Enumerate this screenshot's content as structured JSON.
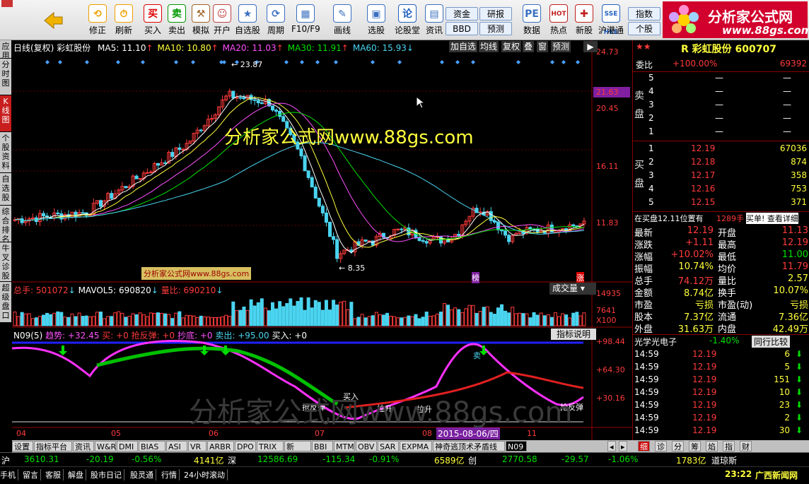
{
  "toolbar": {
    "buttons": [
      {
        "label": "修正",
        "icon": "refresh-icon"
      },
      {
        "label": "刷新",
        "icon": "clock-icon"
      },
      {
        "label": "买入",
        "icon": "buy-icon",
        "glyph": "买"
      },
      {
        "label": "卖出",
        "icon": "sell-icon",
        "glyph": "卖"
      },
      {
        "label": "模拟",
        "icon": "hammer-icon"
      },
      {
        "label": "开户",
        "icon": "person-icon"
      },
      {
        "label": "自选股",
        "icon": "star-icon"
      },
      {
        "label": "周期",
        "icon": "cycle-icon"
      },
      {
        "label": "F10/F9",
        "icon": "f10-icon"
      },
      {
        "label": "画线",
        "icon": "pencil-icon"
      },
      {
        "label": "选股",
        "icon": "screen-icon"
      },
      {
        "label": "论股堂",
        "icon": "forum-icon",
        "glyph": "论"
      },
      {
        "label": "资讯",
        "icon": "news-icon"
      },
      {
        "label": "数据",
        "icon": "pe-icon",
        "glyph": "PE"
      },
      {
        "label": "热点",
        "icon": "hot-icon",
        "glyph": "HOT"
      },
      {
        "label": "新股",
        "icon": "ipo-icon"
      },
      {
        "label": "沪港通",
        "icon": "hk-connect-icon",
        "glyph": "SSE HKE"
      }
    ],
    "paired": [
      [
        "资金",
        "BBD"
      ],
      [
        "研报",
        "预测"
      ],
      [
        "指数",
        "个股"
      ]
    ]
  },
  "logo": {
    "text": "分析家公式网",
    "url": "www.88gs.com"
  },
  "sidebar": [
    "应用",
    "分时图",
    "K线图",
    "个股资料",
    "自选股",
    "综合排名",
    "牛叉诊股",
    "超级盘口"
  ],
  "chart": {
    "header": {
      "mode": "日线(复权)",
      "stock": "彩虹股份",
      "ma": [
        {
          "label": "MA5: 11.10",
          "color": "#ffffff"
        },
        {
          "label": "MA10: 10.80",
          "color": "#ffff3c"
        },
        {
          "label": "MA20: 11.03",
          "color": "#ff50ff"
        },
        {
          "label": "MA30: 11.91",
          "color": "#00e000"
        },
        {
          "label": "MA60: 15.93",
          "color": "#4ad4f0"
        }
      ],
      "buttons": [
        "加自选",
        "均线",
        "复权",
        "叠",
        "窗",
        "预测"
      ]
    },
    "price_axis": [
      "24.73",
      "21.63",
      "20.45",
      "16.11",
      "11.83"
    ],
    "high_label": "23.87",
    "low_label": "8.35",
    "watermark": "分析家公式网www.88gs.com",
    "small_watermark": "分析家公式网www.88gs.com",
    "bang": "榜",
    "zhang": "涨",
    "volume": {
      "total": "总手: 501072",
      "mavol": "MAVOL5: 690820",
      "ratio": "量比: 690210",
      "select": "成交量",
      "axis": [
        "14935",
        "7641",
        "X100"
      ]
    },
    "indicator": {
      "name": "N09(5)",
      "trend": "趋势: +32.45",
      "buy": "买: +0",
      "rebound": "抢反弹: +0",
      "bottom": "抄底: +0",
      "sell": "卖出: +95.00",
      "buyin": "买入: +0",
      "explain": "指标说明",
      "axis": [
        "+98.44",
        "+64.30",
        "+30.16"
      ],
      "labels": [
        "抢反弹",
        "买入",
        "拉升",
        "拉升",
        "抢反弹",
        "卖"
      ]
    },
    "dates": [
      "04",
      "05",
      "06",
      "07",
      "08",
      "11"
    ],
    "date_highlight": "2015-08-06/四",
    "faint_watermark": "分析家公式网www.88gs.com"
  },
  "quote": {
    "title": "R 彩虹股份 600707",
    "weibi": {
      "label": "委比",
      "pct": "+100.00%",
      "val": "69392"
    },
    "sell": [
      {
        "n": "5",
        "p": "—",
        "v": "—"
      },
      {
        "n": "4",
        "p": "—",
        "v": "—"
      },
      {
        "n": "3",
        "p": "—",
        "v": "—"
      },
      {
        "n": "2",
        "p": "—",
        "v": "—"
      },
      {
        "n": "1",
        "p": "—",
        "v": "—"
      }
    ],
    "buy": [
      {
        "n": "1",
        "p": "12.19",
        "v": "67036"
      },
      {
        "n": "2",
        "p": "12.18",
        "v": "874"
      },
      {
        "n": "3",
        "p": "12.17",
        "v": "358"
      },
      {
        "n": "4",
        "p": "12.16",
        "v": "753"
      },
      {
        "n": "5",
        "p": "12.15",
        "v": "371"
      }
    ],
    "sell_side_label": "卖盘",
    "buy_side_label": "买盘",
    "note": "在买盘12.11位置有",
    "note_vol": "1289手",
    "note_link": "买单! 查看详细",
    "stats": [
      [
        "最新",
        "12.19",
        "开盘",
        "11.13"
      ],
      [
        "涨跌",
        "+1.11",
        "最高",
        "12.19"
      ],
      [
        "涨幅",
        "+10.02%",
        "最低",
        "11.00"
      ],
      [
        "振幅",
        "10.74%",
        "均价",
        "11.79"
      ],
      [
        "总手",
        "74.12万",
        "量比",
        "2.57"
      ],
      [
        "金额",
        "8.74亿",
        "换手",
        "10.07%"
      ],
      [
        "市盈",
        "亏损",
        "市盈(动)",
        "亏损"
      ],
      [
        "股本",
        "7.37亿",
        "流通",
        "7.36亿"
      ],
      [
        "外盘",
        "31.63万",
        "内盘",
        "42.49万"
      ]
    ],
    "sector": "光学光电子",
    "sector_pct": "-1.40%",
    "sector_btn": "同行比较",
    "trades": [
      [
        "14:59",
        "12.19",
        "6"
      ],
      [
        "14:59",
        "12.19",
        "5"
      ],
      [
        "14:59",
        "12.19",
        "151"
      ],
      [
        "14:59",
        "12.19",
        "10"
      ],
      [
        "14:59",
        "12.19",
        "23"
      ],
      [
        "14:59",
        "12.19",
        "2"
      ],
      [
        "14:59",
        "12.19",
        "30"
      ]
    ]
  },
  "tabs": [
    "设置",
    "指标平台",
    "资讯",
    "W&R",
    "DMI",
    "BIAS",
    "ASI",
    "VR",
    "ARBR",
    "DPO",
    "TRIX",
    "新DMA",
    "BBI",
    "MTM",
    "OBV",
    "SAR",
    "EXPMA",
    "神奇逃顶术矛盾线",
    "N09"
  ],
  "right_tabs": [
    "细",
    "诊",
    "分",
    "筹",
    "焰",
    "指",
    "财"
  ],
  "ticker": {
    "sh_label": "沪",
    "sh": "3610.31",
    "sh_chg": "-20.19",
    "sh_pct": "-0.56%",
    "sh_amt": "4141亿",
    "sz_label": "深",
    "sz": "12586.69",
    "sz_chg": "-115.34",
    "sz_pct": "-0.91%",
    "sz_amt": "6589亿",
    "cy_label": "创",
    "cy": "2770.58",
    "cy_chg": "-29.57",
    "cy_pct": "-1.06%",
    "cy_amt": "1783亿",
    "dj": "道琼斯"
  },
  "statusbar": {
    "items": [
      "手机",
      "留言",
      "客服",
      "解盘",
      "股市日记",
      "股灵通",
      "行情",
      "24小时滚动"
    ],
    "time": "23:22",
    "news": "广西新闻网"
  }
}
